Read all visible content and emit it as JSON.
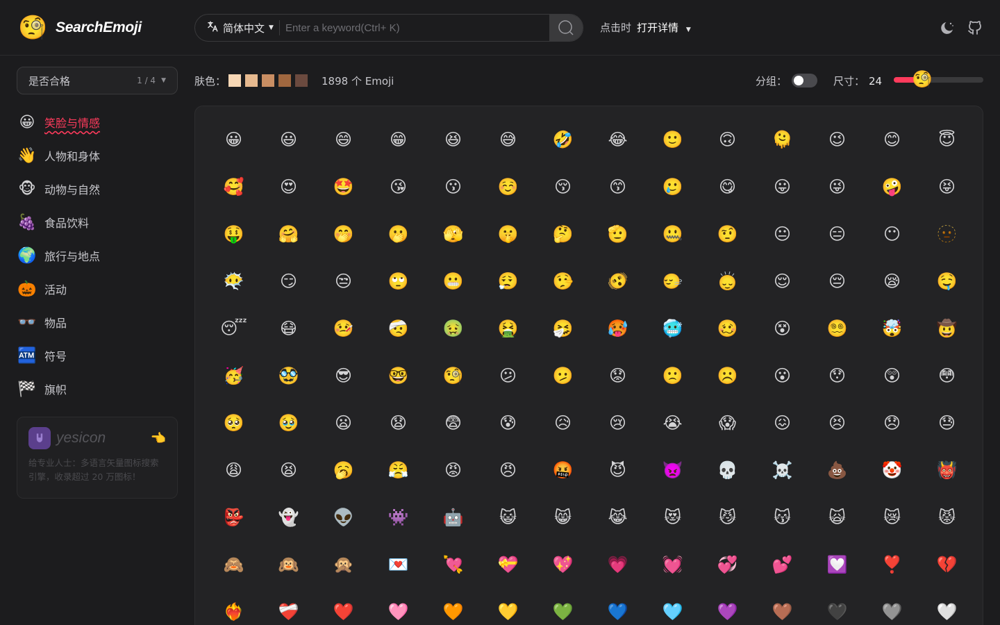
{
  "app": {
    "logo_emoji": "🧐",
    "name": "SearchEmoji"
  },
  "search": {
    "language": "简体中文",
    "placeholder": "Enter a keyword(Ctrl+ K)"
  },
  "click_mode": {
    "label": "点击时",
    "value": "打开详情"
  },
  "header_icons": [
    "moon-icon",
    "github-icon"
  ],
  "filter": {
    "label": "是否合格",
    "count": "1 / 4"
  },
  "categories": [
    {
      "icon": "😀",
      "label": "笑脸与情感",
      "active": true
    },
    {
      "icon": "👋",
      "label": "人物和身体"
    },
    {
      "icon": "🐵",
      "label": "动物与自然"
    },
    {
      "icon": "🍇",
      "label": "食品饮料"
    },
    {
      "icon": "🌍",
      "label": "旅行与地点"
    },
    {
      "icon": "🎃",
      "label": "活动"
    },
    {
      "icon": "👓",
      "label": "物品"
    },
    {
      "icon": "🏧",
      "label": "符号"
    },
    {
      "icon": "🏁",
      "label": "旗帜"
    }
  ],
  "ad": {
    "name": "yesicon",
    "pointer": "👈",
    "text": "给专业人士：多语言矢量图标搜索引擎，收录超过 20 万图标！"
  },
  "toolbar": {
    "skin_label": "肤色：",
    "skin_tones": [
      "#f7d7b5",
      "#e6b98f",
      "#c98e63",
      "#a0673f",
      "#6b4a3f"
    ],
    "count": "1898 个 Emoji",
    "group_label": "分组：",
    "group_enabled": false,
    "size_label": "尺寸：",
    "size_value": "24",
    "size_fill_fraction": 0.31,
    "slider_emoji": "🧐"
  },
  "emojis": [
    "😀",
    "😃",
    "😄",
    "😁",
    "😆",
    "😅",
    "🤣",
    "😂",
    "🙂",
    "🙃",
    "🫠",
    "😉",
    "😊",
    "😇",
    "🥰",
    "😍",
    "🤩",
    "😘",
    "😗",
    "☺️",
    "😚",
    "😙",
    "🥲",
    "😋",
    "😛",
    "😜",
    "🤪",
    "😝",
    "🤑",
    "🤗",
    "🤭",
    "🫢",
    "🫣",
    "🤫",
    "🤔",
    "🫡",
    "🤐",
    "🤨",
    "😐",
    "😑",
    "😶",
    "🫥",
    "😶‍🌫️",
    "😏",
    "😒",
    "🙄",
    "😬",
    "😮‍💨",
    "🤥",
    "🫨",
    "🙂‍↔️",
    "🙂‍↕️",
    "😌",
    "😔",
    "😪",
    "🤤",
    "😴",
    "😷",
    "🤒",
    "🤕",
    "🤢",
    "🤮",
    "🤧",
    "🥵",
    "🥶",
    "🥴",
    "😵",
    "😵‍💫",
    "🤯",
    "🤠",
    "🥳",
    "🥸",
    "😎",
    "🤓",
    "🧐",
    "😕",
    "🫤",
    "😟",
    "🙁",
    "☹️",
    "😮",
    "😯",
    "😲",
    "😳",
    "🥺",
    "🥹",
    "😦",
    "😧",
    "😨",
    "😰",
    "😥",
    "😢",
    "😭",
    "😱",
    "😖",
    "😣",
    "😞",
    "😓",
    "😩",
    "😫",
    "🥱",
    "😤",
    "😡",
    "😠",
    "🤬",
    "😈",
    "👿",
    "💀",
    "☠️",
    "💩",
    "🤡",
    "👹",
    "👺",
    "👻",
    "👽",
    "👾",
    "🤖",
    "😺",
    "😸",
    "😹",
    "😻",
    "😼",
    "😽",
    "🙀",
    "😿",
    "😾",
    "🙈",
    "🙉",
    "🙊",
    "💌",
    "💘",
    "💝",
    "💖",
    "💗",
    "💓",
    "💞",
    "💕",
    "💟",
    "❣️",
    "💔",
    "❤️‍🔥",
    "❤️‍🩹",
    "❤️",
    "🩷",
    "🧡",
    "💛",
    "💚",
    "💙",
    "🩵",
    "💜",
    "🤎",
    "🖤",
    "🩶",
    "🤍"
  ]
}
